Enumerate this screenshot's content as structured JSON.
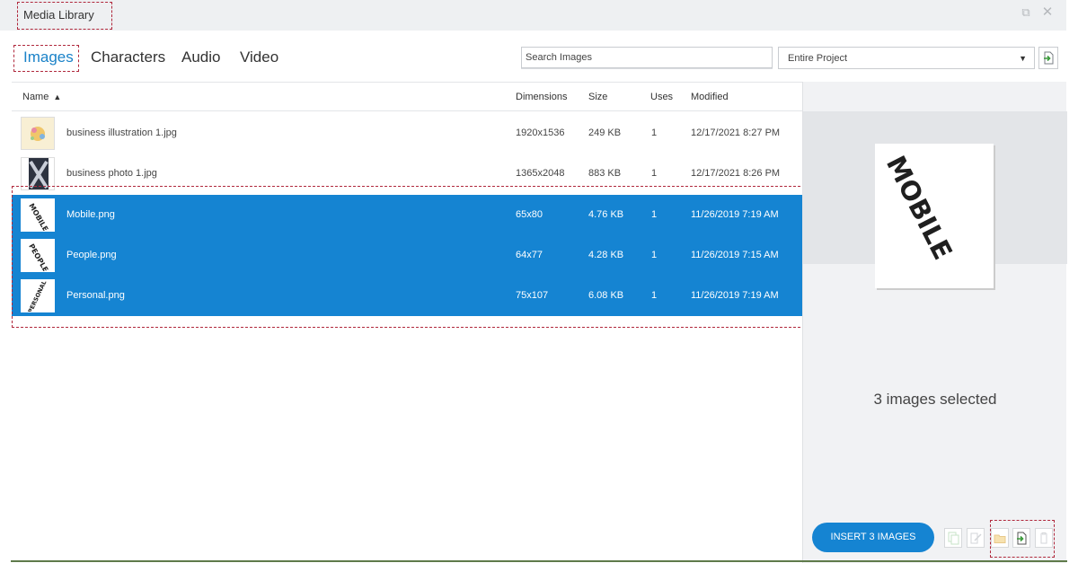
{
  "window": {
    "title": "Media Library",
    "restore_icon": "restore-icon",
    "close_icon": "close-icon"
  },
  "tabs": [
    {
      "label": "Images",
      "active": true
    },
    {
      "label": "Characters",
      "active": false
    },
    {
      "label": "Audio",
      "active": false
    },
    {
      "label": "Video",
      "active": false
    }
  ],
  "search": {
    "value": "Search Images"
  },
  "scope": {
    "value": "Entire Project"
  },
  "table": {
    "headers": {
      "name": "Name",
      "dimensions": "Dimensions",
      "size": "Size",
      "uses": "Uses",
      "modified": "Modified"
    },
    "sort": {
      "column": "Name",
      "direction": "ascending"
    },
    "rows": [
      {
        "name": "business illustration 1.jpg",
        "dimensions": "1920x1536",
        "size": "249 KB",
        "uses": "1",
        "modified": "12/17/2021 8:27 PM",
        "selected": false,
        "thumb": "illustration"
      },
      {
        "name": "business photo 1.jpg",
        "dimensions": "1365x2048",
        "size": "883 KB",
        "uses": "1",
        "modified": "12/17/2021 8:26 PM",
        "selected": false,
        "thumb": "photo"
      },
      {
        "name": "Mobile.png",
        "dimensions": "65x80",
        "size": "4.76 KB",
        "uses": "1",
        "modified": "11/26/2019 7:19 AM",
        "selected": true,
        "thumb": "MOBILE"
      },
      {
        "name": "People.png",
        "dimensions": "64x77",
        "size": "4.28 KB",
        "uses": "1",
        "modified": "11/26/2019 7:15 AM",
        "selected": true,
        "thumb": "PEOPLE"
      },
      {
        "name": "Personal.png",
        "dimensions": "75x107",
        "size": "6.08 KB",
        "uses": "1",
        "modified": "11/26/2019 7:19 AM",
        "selected": true,
        "thumb": "PERSONAL"
      }
    ]
  },
  "preview": {
    "word": "MOBILE"
  },
  "side": {
    "selected_text": "3 images selected",
    "insert_label": "INSERT 3 IMAGES",
    "tools": [
      "duplicate-icon",
      "edit-icon",
      "folder-icon",
      "import-icon",
      "delete-icon"
    ]
  },
  "colors": {
    "accent": "#1584d2",
    "tab_active": "#1a82c8",
    "highlight_box": "#b0283c"
  }
}
